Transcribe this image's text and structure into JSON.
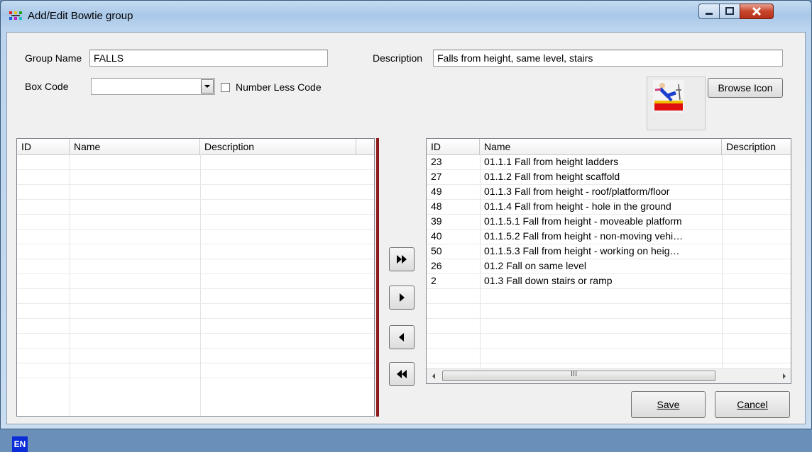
{
  "window": {
    "title": "Add/Edit Bowtie group"
  },
  "form": {
    "group_name_label": "Group Name",
    "group_name_value": "FALLS",
    "description_label": "Description",
    "description_value": "Falls from height, same level, stairs",
    "box_code_label": "Box Code",
    "box_code_value": "",
    "number_less_code_label": "Number Less Code",
    "number_less_code_checked": false,
    "browse_icon_label": "Browse Icon"
  },
  "left_grid": {
    "columns": [
      "ID",
      "Name",
      "Description"
    ],
    "rows": []
  },
  "right_grid": {
    "columns": [
      "ID",
      "Name",
      "Description"
    ],
    "rows": [
      {
        "id": "23",
        "name": "01.1.1 Fall from height ladders"
      },
      {
        "id": "27",
        "name": "01.1.2 Fall from height scaffold"
      },
      {
        "id": "49",
        "name": "01.1.3 Fall from height - roof/platform/floor"
      },
      {
        "id": "48",
        "name": "01.1.4 Fall from height - hole in the ground"
      },
      {
        "id": "39",
        "name": "01.1.5.1 Fall from height - moveable platform"
      },
      {
        "id": "40",
        "name": "01.1.5.2 Fall from height - non-moving vehi…"
      },
      {
        "id": "50",
        "name": "01.1.5.3 Fall from height - working on heig…"
      },
      {
        "id": "26",
        "name": "01.2 Fall on same level"
      },
      {
        "id": "2",
        "name": "01.3 Fall down stairs or ramp"
      }
    ],
    "scroll_thumb_label": "III"
  },
  "buttons": {
    "save": "Save",
    "cancel": "Cancel"
  },
  "status": {
    "language": "EN"
  },
  "icons": {
    "move_all_right": "double-right-arrow-icon",
    "move_right": "right-arrow-icon",
    "move_left": "left-arrow-icon",
    "move_all_left": "double-left-arrow-icon"
  },
  "colors": {
    "splitter": "#8c1a1a",
    "language_badge": "#0a2dd8",
    "close_button": "#c7452b"
  }
}
